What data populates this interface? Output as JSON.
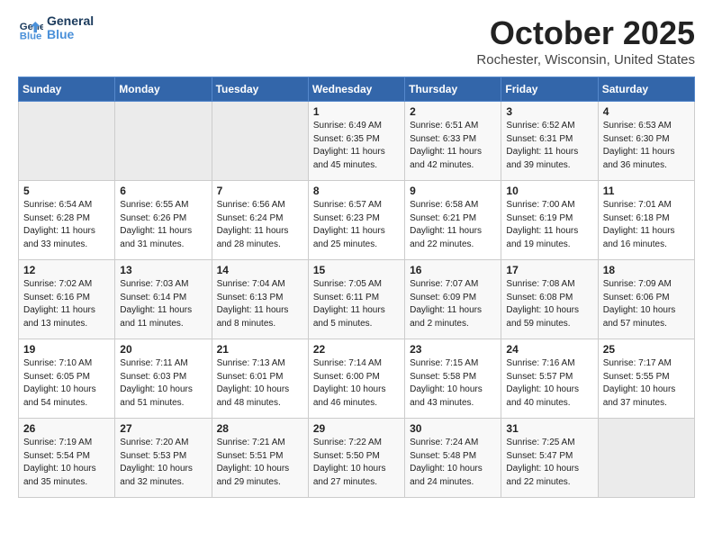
{
  "header": {
    "logo_line1": "General",
    "logo_line2": "Blue",
    "month_title": "October 2025",
    "location": "Rochester, Wisconsin, United States"
  },
  "weekdays": [
    "Sunday",
    "Monday",
    "Tuesday",
    "Wednesday",
    "Thursday",
    "Friday",
    "Saturday"
  ],
  "weeks": [
    [
      {
        "day": "",
        "info": ""
      },
      {
        "day": "",
        "info": ""
      },
      {
        "day": "",
        "info": ""
      },
      {
        "day": "1",
        "info": "Sunrise: 6:49 AM\nSunset: 6:35 PM\nDaylight: 11 hours\nand 45 minutes."
      },
      {
        "day": "2",
        "info": "Sunrise: 6:51 AM\nSunset: 6:33 PM\nDaylight: 11 hours\nand 42 minutes."
      },
      {
        "day": "3",
        "info": "Sunrise: 6:52 AM\nSunset: 6:31 PM\nDaylight: 11 hours\nand 39 minutes."
      },
      {
        "day": "4",
        "info": "Sunrise: 6:53 AM\nSunset: 6:30 PM\nDaylight: 11 hours\nand 36 minutes."
      }
    ],
    [
      {
        "day": "5",
        "info": "Sunrise: 6:54 AM\nSunset: 6:28 PM\nDaylight: 11 hours\nand 33 minutes."
      },
      {
        "day": "6",
        "info": "Sunrise: 6:55 AM\nSunset: 6:26 PM\nDaylight: 11 hours\nand 31 minutes."
      },
      {
        "day": "7",
        "info": "Sunrise: 6:56 AM\nSunset: 6:24 PM\nDaylight: 11 hours\nand 28 minutes."
      },
      {
        "day": "8",
        "info": "Sunrise: 6:57 AM\nSunset: 6:23 PM\nDaylight: 11 hours\nand 25 minutes."
      },
      {
        "day": "9",
        "info": "Sunrise: 6:58 AM\nSunset: 6:21 PM\nDaylight: 11 hours\nand 22 minutes."
      },
      {
        "day": "10",
        "info": "Sunrise: 7:00 AM\nSunset: 6:19 PM\nDaylight: 11 hours\nand 19 minutes."
      },
      {
        "day": "11",
        "info": "Sunrise: 7:01 AM\nSunset: 6:18 PM\nDaylight: 11 hours\nand 16 minutes."
      }
    ],
    [
      {
        "day": "12",
        "info": "Sunrise: 7:02 AM\nSunset: 6:16 PM\nDaylight: 11 hours\nand 13 minutes."
      },
      {
        "day": "13",
        "info": "Sunrise: 7:03 AM\nSunset: 6:14 PM\nDaylight: 11 hours\nand 11 minutes."
      },
      {
        "day": "14",
        "info": "Sunrise: 7:04 AM\nSunset: 6:13 PM\nDaylight: 11 hours\nand 8 minutes."
      },
      {
        "day": "15",
        "info": "Sunrise: 7:05 AM\nSunset: 6:11 PM\nDaylight: 11 hours\nand 5 minutes."
      },
      {
        "day": "16",
        "info": "Sunrise: 7:07 AM\nSunset: 6:09 PM\nDaylight: 11 hours\nand 2 minutes."
      },
      {
        "day": "17",
        "info": "Sunrise: 7:08 AM\nSunset: 6:08 PM\nDaylight: 10 hours\nand 59 minutes."
      },
      {
        "day": "18",
        "info": "Sunrise: 7:09 AM\nSunset: 6:06 PM\nDaylight: 10 hours\nand 57 minutes."
      }
    ],
    [
      {
        "day": "19",
        "info": "Sunrise: 7:10 AM\nSunset: 6:05 PM\nDaylight: 10 hours\nand 54 minutes."
      },
      {
        "day": "20",
        "info": "Sunrise: 7:11 AM\nSunset: 6:03 PM\nDaylight: 10 hours\nand 51 minutes."
      },
      {
        "day": "21",
        "info": "Sunrise: 7:13 AM\nSunset: 6:01 PM\nDaylight: 10 hours\nand 48 minutes."
      },
      {
        "day": "22",
        "info": "Sunrise: 7:14 AM\nSunset: 6:00 PM\nDaylight: 10 hours\nand 46 minutes."
      },
      {
        "day": "23",
        "info": "Sunrise: 7:15 AM\nSunset: 5:58 PM\nDaylight: 10 hours\nand 43 minutes."
      },
      {
        "day": "24",
        "info": "Sunrise: 7:16 AM\nSunset: 5:57 PM\nDaylight: 10 hours\nand 40 minutes."
      },
      {
        "day": "25",
        "info": "Sunrise: 7:17 AM\nSunset: 5:55 PM\nDaylight: 10 hours\nand 37 minutes."
      }
    ],
    [
      {
        "day": "26",
        "info": "Sunrise: 7:19 AM\nSunset: 5:54 PM\nDaylight: 10 hours\nand 35 minutes."
      },
      {
        "day": "27",
        "info": "Sunrise: 7:20 AM\nSunset: 5:53 PM\nDaylight: 10 hours\nand 32 minutes."
      },
      {
        "day": "28",
        "info": "Sunrise: 7:21 AM\nSunset: 5:51 PM\nDaylight: 10 hours\nand 29 minutes."
      },
      {
        "day": "29",
        "info": "Sunrise: 7:22 AM\nSunset: 5:50 PM\nDaylight: 10 hours\nand 27 minutes."
      },
      {
        "day": "30",
        "info": "Sunrise: 7:24 AM\nSunset: 5:48 PM\nDaylight: 10 hours\nand 24 minutes."
      },
      {
        "day": "31",
        "info": "Sunrise: 7:25 AM\nSunset: 5:47 PM\nDaylight: 10 hours\nand 22 minutes."
      },
      {
        "day": "",
        "info": ""
      }
    ]
  ]
}
